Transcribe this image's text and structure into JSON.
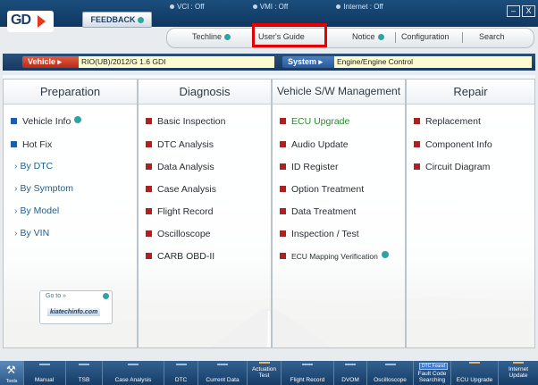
{
  "status": {
    "vci": "VCI : Off",
    "vmi": "VMI : Off",
    "internet": "Internet : Off"
  },
  "window": {
    "minimize": "–",
    "close": "X"
  },
  "logo": {
    "text": "GD"
  },
  "feedback": {
    "label": "FEEDBACK"
  },
  "top_menu": {
    "techline": "Techline",
    "users_guide": "User's Guide",
    "notice": "Notice",
    "configuration": "Configuration",
    "search": "Search"
  },
  "vehicle": {
    "label": "Vehicle",
    "value": "RIO(UB)/2012/G 1.6 GDI"
  },
  "system": {
    "label": "System",
    "value": "Engine/Engine Control"
  },
  "columns": {
    "preparation": {
      "title": "Preparation",
      "items": [
        "Vehicle Info",
        "Hot Fix"
      ],
      "subitems": [
        "By DTC",
        "By Symptom",
        "By Model",
        "By VIN"
      ]
    },
    "diagnosis": {
      "title": "Diagnosis",
      "items": [
        "Basic Inspection",
        "DTC Analysis",
        "Data Analysis",
        "Case Analysis",
        "Flight Record",
        "Oscilloscope",
        "CARB OBD-II"
      ]
    },
    "vehicle_sw": {
      "title": "Vehicle S/W Management",
      "items": [
        "ECU Upgrade",
        "Audio Update",
        "ID Register",
        "Option Treatment",
        "Data Treatment",
        "Inspection / Test",
        "ECU Mapping Verification"
      ]
    },
    "repair": {
      "title": "Repair",
      "items": [
        "Replacement",
        "Component Info",
        "Circuit Diagram"
      ]
    }
  },
  "kia_link": {
    "goto": "Go to",
    "site": "kiatechinfo.com"
  },
  "toolbar": {
    "tools": "Tools",
    "items": [
      "Manual",
      "TSB",
      "Case Analysis",
      "DTC",
      "Current Data",
      "Actuation Test",
      "Flight Record",
      "DVOM",
      "Oscilloscope",
      "Fault Code Searching",
      "ECU Upgrade",
      "Internet Update"
    ],
    "dtc_found_badge": "DTC Found"
  },
  "colors": {
    "title_bar": "#0f3660",
    "highlight": "#e60000",
    "vehicle_pill": "#c4321e",
    "system_pill": "#3a6cae",
    "info_dot": "#2ea3a4",
    "ecu_upgrade_text": "#2d8a2d"
  },
  "icons": {
    "status": "status-dot-icon",
    "bullet": "square-bullet-icon",
    "info": "info-icon",
    "tools": "tools-icon"
  }
}
